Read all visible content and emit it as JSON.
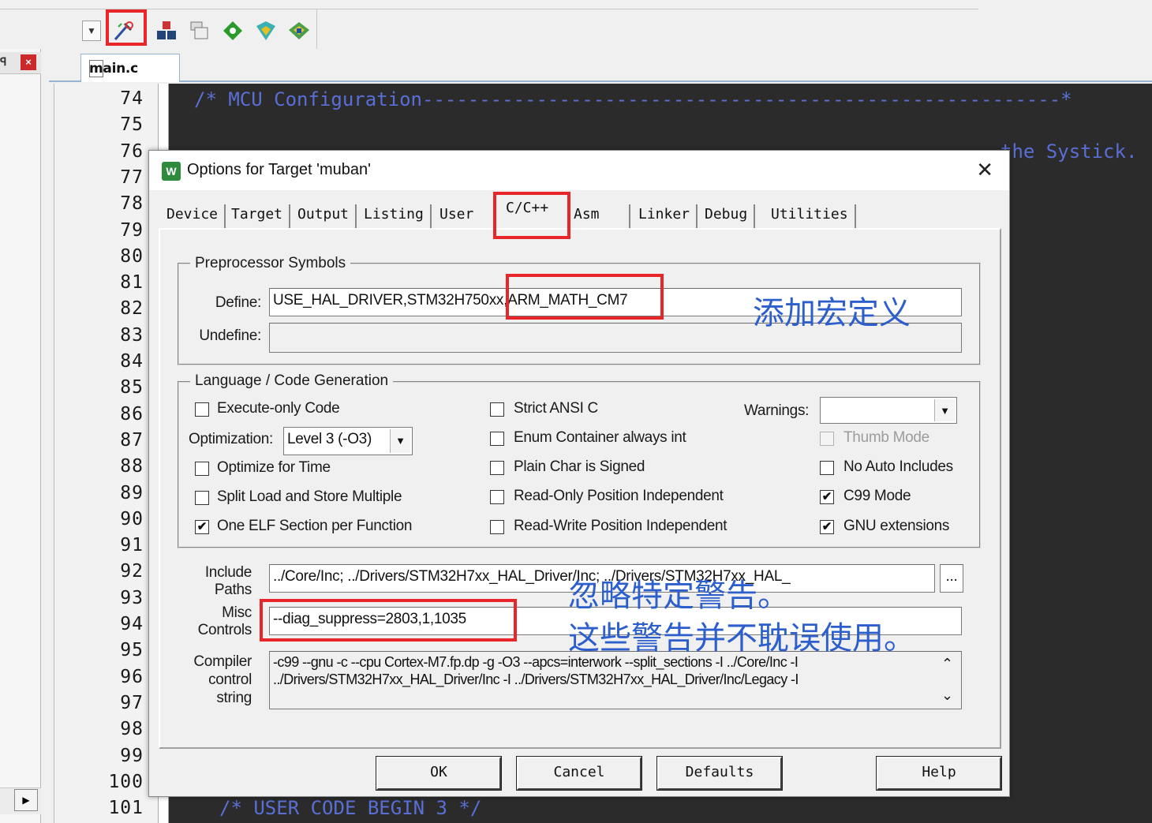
{
  "editor": {
    "file_tab": "main.c",
    "line_numbers": [
      "74",
      "75",
      "76",
      "77",
      "78",
      "79",
      "80",
      "81",
      "82",
      "83",
      "84",
      "85",
      "86",
      "87",
      "88",
      "89",
      "90",
      "91",
      "92",
      "93",
      "94",
      "95",
      "96",
      "97",
      "98",
      "99",
      "100",
      "101"
    ],
    "code_line_74": "/* MCU Configuration--------------------------------------------------------*",
    "code_line_76_tail": "the Systick.",
    "code_line_101": "/* USER CODE BEGIN 3 */"
  },
  "toolbar": {
    "dropdown_arrow": "▼",
    "icons": [
      "options-for-target-icon",
      "manage-components-icon",
      "copy-icon",
      "diamond-icon",
      "pack-installer-icon",
      "select-packs-icon"
    ]
  },
  "left_panel": {
    "pin": "ꟼ",
    "close": "×",
    "scroll_right": "▶"
  },
  "dialog": {
    "icon_text": "W",
    "title": "Options for Target 'muban'",
    "close": "✕",
    "tabs": [
      "Device",
      "Target",
      "Output",
      "Listing",
      "User",
      "C/C++",
      "Asm",
      "Linker",
      "Debug",
      "Utilities"
    ],
    "active_tab": "C/C++",
    "preprocessor": {
      "group_label": "Preprocessor Symbols",
      "define_label": "Define:",
      "define_value": "USE_HAL_DRIVER,STM32H750xx,ARM_MATH_CM7",
      "undefine_label": "Undefine:",
      "undefine_value": ""
    },
    "language": {
      "group_label": "Language / Code Generation",
      "execute_only": {
        "label": "Execute-only Code",
        "checked": false
      },
      "optimization_label": "Optimization:",
      "optimization_value": "Level 3 (-O3)",
      "optimize_time": {
        "label": "Optimize for Time",
        "checked": false
      },
      "split_load": {
        "label": "Split Load and Store Multiple",
        "checked": false
      },
      "one_elf": {
        "label": "One ELF Section per Function",
        "checked": true,
        "mark": "✔"
      },
      "strict_ansi": {
        "label": "Strict ANSI C",
        "checked": false
      },
      "enum_container": {
        "label": "Enum Container always int",
        "checked": false
      },
      "plain_char": {
        "label": "Plain Char is Signed",
        "checked": false
      },
      "ro_pi": {
        "label": "Read-Only Position Independent",
        "checked": false
      },
      "rw_pi": {
        "label": "Read-Write Position Independent",
        "checked": false
      },
      "warnings_label": "Warnings:",
      "warnings_value": "",
      "thumb_mode": {
        "label": "Thumb Mode",
        "checked": false
      },
      "no_auto_includes": {
        "label": "No Auto Includes",
        "checked": false
      },
      "c99_mode": {
        "label": "C99 Mode",
        "checked": true,
        "mark": "✔"
      },
      "gnu_ext": {
        "label": "GNU extensions",
        "checked": true,
        "mark": "✔"
      }
    },
    "include_label_1": "Include",
    "include_label_2": "Paths",
    "include_value": "../Core/Inc;            ../Drivers/STM32H7xx_HAL_Driver/Inc;  ../Drivers/STM32H7xx_HAL_",
    "browse_label": "...",
    "misc_label_1": "Misc",
    "misc_label_2": "Controls",
    "misc_value": "--diag_suppress=2803,1,1035",
    "compiler_label_1": "Compiler",
    "compiler_label_2": "control",
    "compiler_label_3": "string",
    "compiler_line_1": "-c99 --gnu -c --cpu Cortex-M7.fp.dp -g -O3 --apcs=interwork --split_sections -I ../Core/Inc -I",
    "compiler_line_2": "../Drivers/STM32H7xx_HAL_Driver/Inc -I ../Drivers/STM32H7xx_HAL_Driver/Inc/Legacy -I",
    "scroll_up": "⌃",
    "scroll_down": "⌄",
    "buttons": {
      "ok": "OK",
      "cancel": "Cancel",
      "defaults": "Defaults",
      "help": "Help"
    }
  },
  "annotations": {
    "add_macro": "添加宏定义",
    "ignore_warning": "忽略特定警告。",
    "warning_note": "这些警告并不耽误使用。"
  },
  "colors": {
    "highlight": "#e8262a",
    "annotation": "#2d5fcc",
    "code_bg": "#2b2b2b",
    "code_comment": "#5a6fd6"
  }
}
